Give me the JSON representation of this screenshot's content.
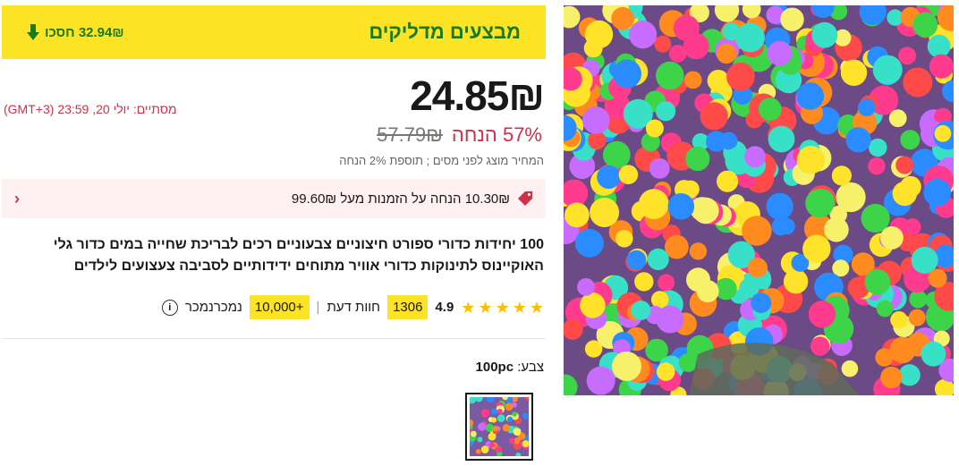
{
  "banner": {
    "title": "מבצעים מדליקים",
    "save_text": "32.94₪ חסכו"
  },
  "price": {
    "current": "24.85₪",
    "original": "57.79₪",
    "discount": "57% הנחה"
  },
  "ends_text": "מסתיים:  יולי 20, 23:59 (GMT+3)",
  "tax_note": "המחיר מוצג לפני מסים ; תוספת 2% הנחה",
  "coupon": {
    "text": "10.30₪ הנחה על הזמנות מעל 99.60₪"
  },
  "product": {
    "title": "100 יחידות כדורי ספורט חיצוניים צבעוניים רכים לבריכת שחייה במים כדור גלי האוקיינוס לתינוקות כדורי אוויר מתוחים ידידותיים לסביבה צעצועים לילדים"
  },
  "stats": {
    "rating": "4.9",
    "reviews_count": "1306",
    "reviews_label": "חוות דעת",
    "sold_count": "+10,000",
    "sold_label": "נמכרנמכר"
  },
  "color": {
    "label": "צבע:",
    "value": "100pc"
  },
  "icons": [
    "arrow-down-icon",
    "tag-icon",
    "chevron-right-icon",
    "star-icon",
    "info-icon"
  ],
  "colors": {
    "banner_bg": "#fde326",
    "banner_text": "#1a7a1a",
    "sale_red": "#d0304a",
    "star": "#fcbf00"
  }
}
